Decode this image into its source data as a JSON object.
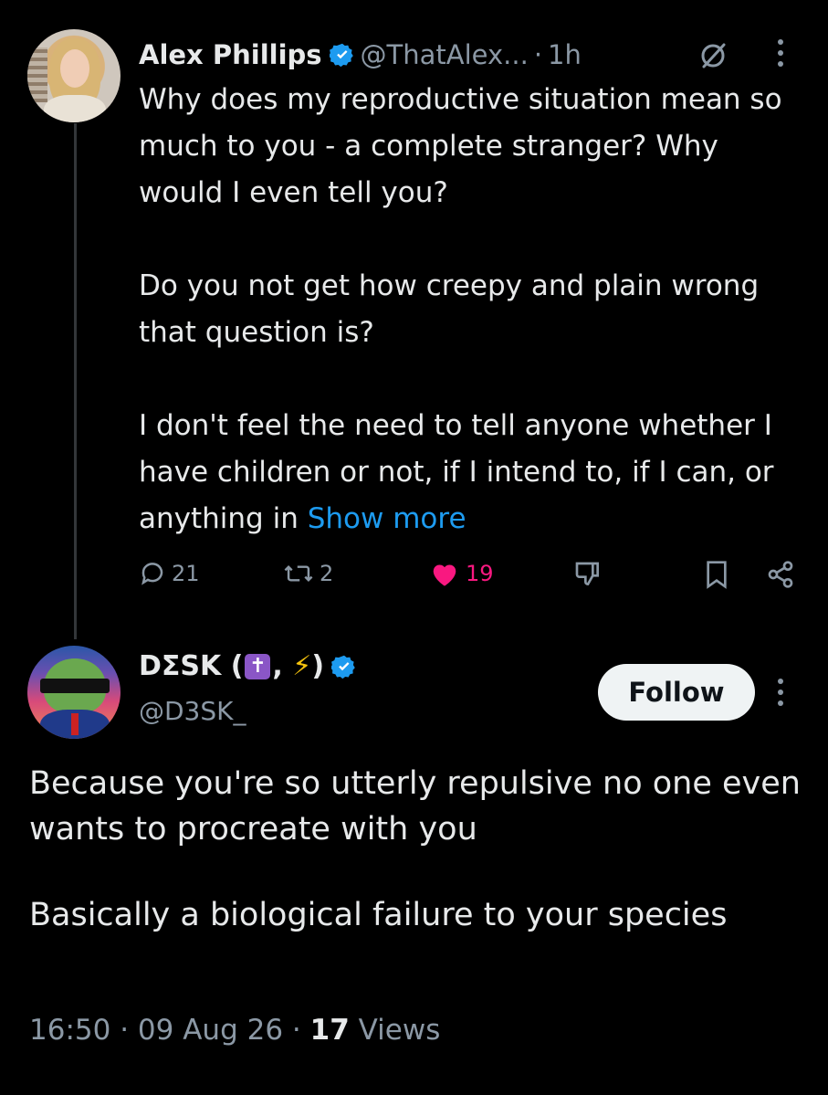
{
  "tweet1": {
    "author_name": "Alex Phillips",
    "handle": "@ThatAlex...",
    "separator": "·",
    "time": "1h",
    "paragraphs": [
      "Why does my reproductive situation mean so much to you - a complete stranger? Why would I even tell you?",
      "Do you not get how creepy and plain wrong that question is?",
      "I don't feel the need to tell anyone whether I have children or not, if I intend to, if I can, or anything in"
    ],
    "show_more": "Show more",
    "actions": {
      "replies": "21",
      "reposts": "2",
      "likes": "19"
    }
  },
  "tweet2": {
    "author_name_prefix": "DΣSK (",
    "author_name_emoji1": "✝",
    "author_name_sep": ", ",
    "author_name_emoji2": "⚡",
    "author_name_suffix": ")",
    "handle": "@D3SK_",
    "follow_label": "Follow",
    "paragraphs": [
      "Because you're so utterly repulsive no one even wants to procreate with you",
      "Basically a biological failure to your species"
    ],
    "time": "16:50",
    "date": "09 Aug 26",
    "views_count": "17",
    "views_label": "Views",
    "separator": "·"
  },
  "colors": {
    "background": "#000000",
    "text": "#e7e9ea",
    "muted": "#8b98a5",
    "link": "#1d9bf0",
    "like": "#f91880",
    "verified": "#1d9bf0"
  },
  "icons": [
    "verified-badge-icon",
    "grok-icon",
    "more-icon",
    "reply-icon",
    "repost-icon",
    "heart-icon",
    "downvote-icon",
    "bookmark-icon",
    "share-icon"
  ]
}
